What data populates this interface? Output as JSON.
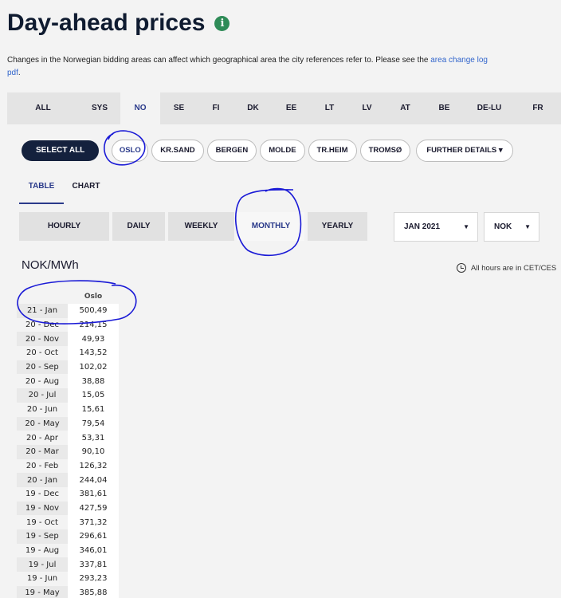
{
  "header": {
    "title": "Day-ahead prices",
    "info_icon": "info-icon"
  },
  "notice": {
    "text": "Changes in the Norwegian bidding areas can affect which geographical area the city references refer to. Please see the ",
    "link_text": "area change log pdf",
    "suffix": "."
  },
  "area_tabs": [
    {
      "label": "ALL"
    },
    {
      "label": "SYS"
    },
    {
      "label": "NO"
    },
    {
      "label": "SE"
    },
    {
      "label": "FI"
    },
    {
      "label": "DK"
    },
    {
      "label": "EE"
    },
    {
      "label": "LT"
    },
    {
      "label": "LV"
    },
    {
      "label": "AT"
    },
    {
      "label": "BE"
    },
    {
      "label": "DE-LU"
    },
    {
      "label": "FR"
    }
  ],
  "active_area": "NO",
  "cities": {
    "select_all": "SELECT ALL",
    "items": [
      {
        "label": "OSLO"
      },
      {
        "label": "KR.SAND"
      },
      {
        "label": "BERGEN"
      },
      {
        "label": "MOLDE"
      },
      {
        "label": "TR.HEIM"
      },
      {
        "label": "TROMSØ"
      }
    ],
    "further_details": "FURTHER DETAILS ▾"
  },
  "view_tabs": [
    {
      "label": "TABLE"
    },
    {
      "label": "CHART"
    }
  ],
  "period_buttons": [
    {
      "label": "HOURLY"
    },
    {
      "label": "DAILY"
    },
    {
      "label": "WEEKLY"
    },
    {
      "label": "MONTHLY"
    },
    {
      "label": "YEARLY"
    }
  ],
  "month_select": {
    "value": "JAN 2021"
  },
  "currency_select": {
    "value": "NOK"
  },
  "unit_label": "NOK/MWh",
  "timezone_note": "All hours are in CET/CES",
  "table": {
    "column_header": "Oslo",
    "rows": [
      {
        "month": "21 - Jan",
        "value": "500,49"
      },
      {
        "month": "20 - Dec",
        "value": "214,15"
      },
      {
        "month": "20 - Nov",
        "value": "49,93"
      },
      {
        "month": "20 - Oct",
        "value": "143,52"
      },
      {
        "month": "20 - Sep",
        "value": "102,02"
      },
      {
        "month": "20 - Aug",
        "value": "38,88"
      },
      {
        "month": "20 - Jul",
        "value": "15,05"
      },
      {
        "month": "20 - Jun",
        "value": "15,61"
      },
      {
        "month": "20 - May",
        "value": "79,54"
      },
      {
        "month": "20 - Apr",
        "value": "53,31"
      },
      {
        "month": "20 - Mar",
        "value": "90,10"
      },
      {
        "month": "20 - Feb",
        "value": "126,32"
      },
      {
        "month": "20 - Jan",
        "value": "244,04"
      },
      {
        "month": "19 - Dec",
        "value": "381,61"
      },
      {
        "month": "19 - Nov",
        "value": "427,59"
      },
      {
        "month": "19 - Oct",
        "value": "371,32"
      },
      {
        "month": "19 - Sep",
        "value": "296,61"
      },
      {
        "month": "19 - Aug",
        "value": "346,01"
      },
      {
        "month": "19 - Jul",
        "value": "337,81"
      },
      {
        "month": "19 - Jun",
        "value": "293,23"
      },
      {
        "month": "19 - May",
        "value": "385,88"
      }
    ]
  },
  "colors": {
    "annotation_ink": "#1a1ad6",
    "navy": "#14213d",
    "active_blue": "#2a3a8a"
  }
}
